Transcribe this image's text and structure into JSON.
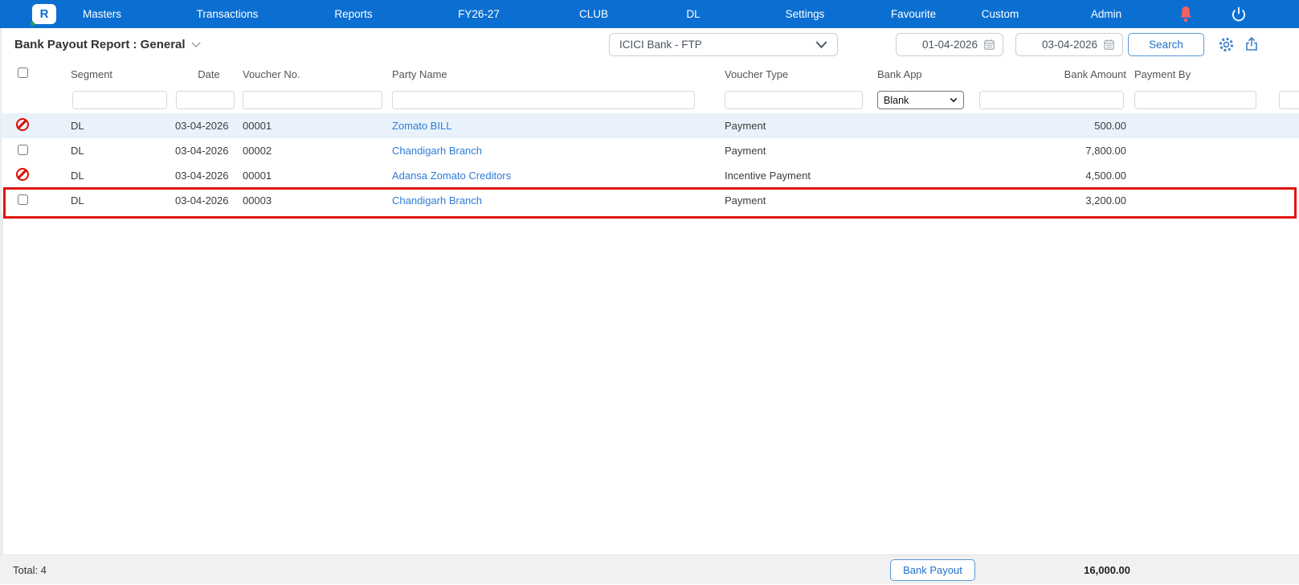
{
  "nav": {
    "logo_glyph": "R",
    "items": [
      "Masters",
      "Transactions",
      "Reports",
      "FY26-27",
      "CLUB",
      "DL",
      "Settings",
      "Favourite",
      "Custom",
      "Admin"
    ]
  },
  "toolbar": {
    "title": "Bank Payout Report : General",
    "bank_select_value": "ICICI Bank - FTP",
    "date_from": "01-04-2026",
    "date_to": "03-04-2026",
    "search_label": "Search"
  },
  "table": {
    "columns": [
      "Segment",
      "Date",
      "Voucher No.",
      "Party Name",
      "Voucher Type",
      "Bank App",
      "Bank Amount",
      "Payment By"
    ],
    "filters": {
      "bank_app_value": "Blank"
    },
    "rows": [
      {
        "marker": "blocked",
        "segment": "DL",
        "date": "03-04-2026",
        "voucher_no": "00001",
        "party": "Zomato BILL",
        "voucher_type": "Payment",
        "bank_app": "",
        "bank_amount": "500.00",
        "payment_by": "",
        "highlighted": true,
        "selected": false
      },
      {
        "marker": "checkbox",
        "segment": "DL",
        "date": "03-04-2026",
        "voucher_no": "00002",
        "party": "Chandigarh Branch",
        "voucher_type": "Payment",
        "bank_app": "",
        "bank_amount": "7,800.00",
        "payment_by": "",
        "highlighted": false,
        "selected": false
      },
      {
        "marker": "blocked",
        "segment": "DL",
        "date": "03-04-2026",
        "voucher_no": "00001",
        "party": "Adansa Zomato Creditors",
        "voucher_type": "Incentive Payment",
        "bank_app": "",
        "bank_amount": "4,500.00",
        "payment_by": "",
        "highlighted": false,
        "selected": false
      },
      {
        "marker": "checkbox",
        "segment": "DL",
        "date": "03-04-2026",
        "voucher_no": "00003",
        "party": "Chandigarh Branch",
        "voucher_type": "Payment",
        "bank_app": "",
        "bank_amount": "3,200.00",
        "payment_by": "",
        "highlighted": false,
        "selected": true
      }
    ]
  },
  "footer": {
    "total_label": "Total: 4",
    "payout_button_label": "Bank Payout",
    "total_amount": "16,000.00"
  },
  "colors": {
    "nav_bar": "#0b6fd1",
    "accent_blue": "#2273c9",
    "link_blue": "#2e7cd6",
    "row_highlight": "#e9f2fb",
    "selected_row_border": "#e01313",
    "blocked_red": "#de0b00",
    "bell_red": "#f4615c",
    "footer_bg": "#f1f1f1"
  }
}
